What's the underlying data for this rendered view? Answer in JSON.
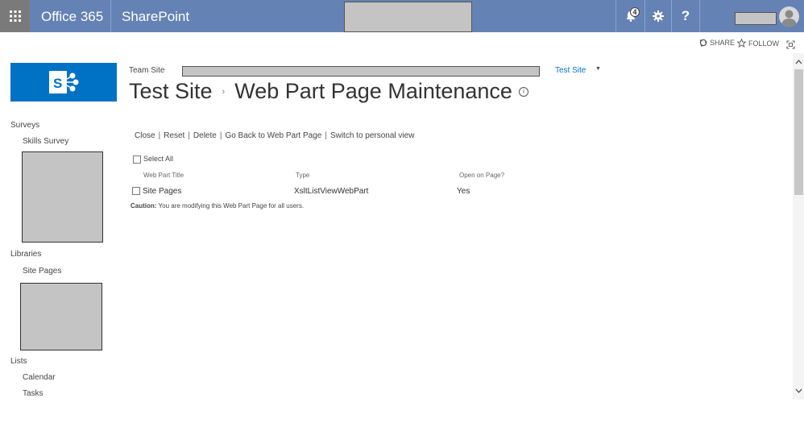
{
  "suite_bar": {
    "brand": "Office 365",
    "app": "SharePoint",
    "notification_count": "4",
    "help_label": "?"
  },
  "actions": {
    "share": "SHARE",
    "follow": "FOLLOW"
  },
  "header": {
    "breadcrumb_root": "Team Site",
    "top_nav_link": "Test Site",
    "top_nav_arrow": "▼",
    "title_site": "Test Site",
    "title_sep": "›",
    "title_page": "Web Part Page Maintenance",
    "info_icon": "i"
  },
  "left_nav": {
    "surveys_heading": "Surveys",
    "surveys_item": "Skills Survey",
    "libraries_heading": "Libraries",
    "libraries_item": "Site Pages",
    "lists_heading": "Lists",
    "lists_items": [
      "Calendar",
      "Tasks"
    ]
  },
  "main": {
    "links": [
      "Close",
      "Reset",
      "Delete",
      "Go Back to Web Part Page",
      "Switch to personal view"
    ],
    "pipe": "|",
    "select_all": "Select All",
    "columns": [
      "Web Part Title",
      "Type",
      "Open on Page?"
    ],
    "rows": [
      {
        "title": "Site Pages",
        "type": "XsltListViewWebPart",
        "open": "Yes"
      }
    ],
    "caution_label": "Caution:",
    "caution_text": " You are modifying this Web Part Page for all users."
  },
  "colors": {
    "suite_bar": "#6582b5",
    "waffle_bg": "#7a7a7a",
    "sharepoint_blue": "#0072c6",
    "redaction": "#c4c4c4"
  },
  "icons": [
    "waffle-icon",
    "bell-icon",
    "gear-icon",
    "help-icon",
    "avatar-icon",
    "share-icon",
    "follow-star-icon",
    "focus-icon",
    "sharepoint-logo",
    "info-icon"
  ]
}
